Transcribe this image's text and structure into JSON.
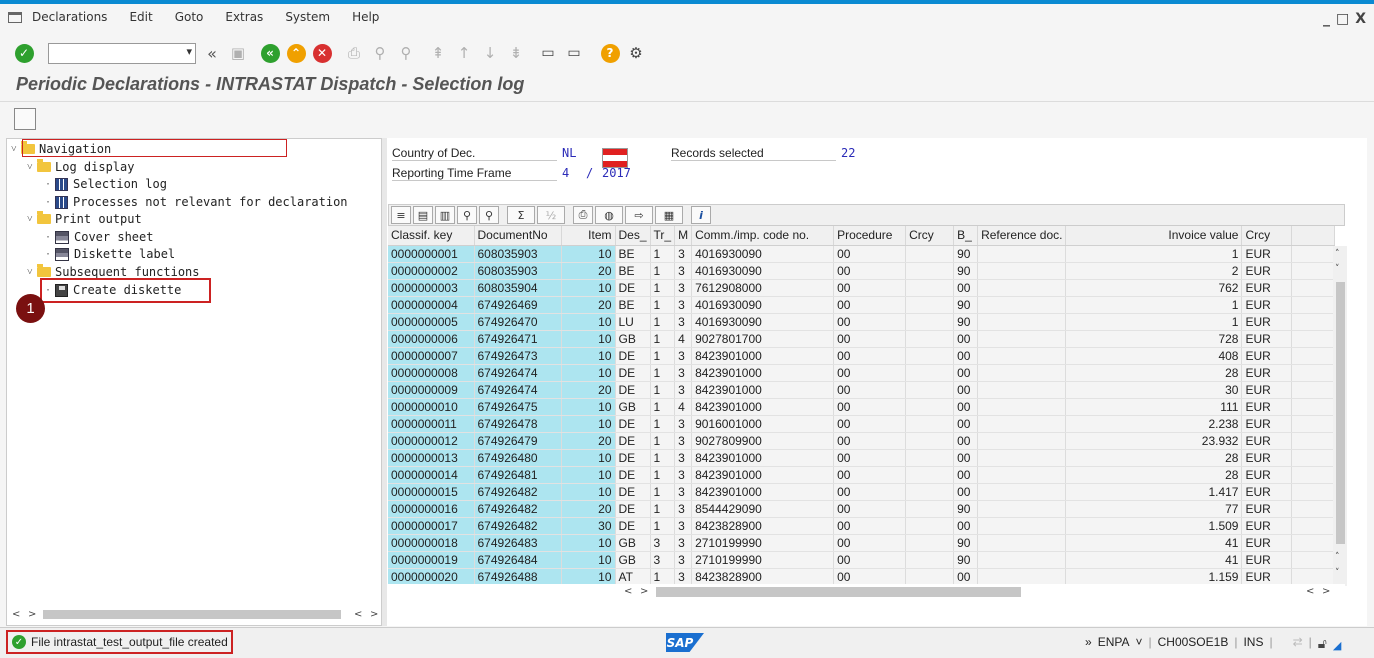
{
  "menu": {
    "items": [
      "Declarations",
      "Edit",
      "Goto",
      "Extras",
      "System",
      "Help"
    ]
  },
  "window_controls": {
    "minimize": "_",
    "maximize": "□",
    "close": "X"
  },
  "toolbar": {
    "command_field": {
      "value": "",
      "dropdown_icon": "chevron-down-icon"
    },
    "buttons": [
      "enter-icon",
      "back-double-icon",
      "save-icon",
      "back-icon",
      "exit-icon",
      "cancel-icon",
      "print-icon",
      "find-icon",
      "find-next-icon",
      "first-page-icon",
      "previous-page-icon",
      "next-page-icon",
      "last-page-icon",
      "new-session-icon",
      "shortcut-icon",
      "help-icon",
      "settings-icon"
    ],
    "colors": {
      "enter": "#2ea02e",
      "back": "#2ea02e",
      "exit": "#f0a000",
      "cancel": "#d83030",
      "help": "#f0a000"
    }
  },
  "page": {
    "title": "Periodic Declarations - INTRASTAT Dispatch - Selection log"
  },
  "tree": {
    "nodes": [
      {
        "label": "Navigation",
        "level": 0,
        "type": "folder"
      },
      {
        "label": "Log display",
        "level": 1,
        "type": "folder"
      },
      {
        "label": "Selection log",
        "level": 2,
        "type": "list"
      },
      {
        "label": "Processes not relevant for declaration",
        "level": 2,
        "type": "list"
      },
      {
        "label": "Print output",
        "level": 1,
        "type": "folder"
      },
      {
        "label": "Cover sheet",
        "level": 2,
        "type": "print"
      },
      {
        "label": "Diskette label",
        "level": 2,
        "type": "print"
      },
      {
        "label": "Subsequent functions",
        "level": 1,
        "type": "folder"
      },
      {
        "label": "Create diskette",
        "level": 2,
        "type": "disk"
      }
    ],
    "annotation_badge": "1"
  },
  "header": {
    "country_label": "Country of Dec.",
    "country_value": "NL",
    "records_label": "Records selected",
    "records_value": "22",
    "period_label": "Reporting Time Frame",
    "period_month": "4",
    "period_sep": "/",
    "period_year": "2017"
  },
  "grid": {
    "toolbar_buttons": [
      "details-icon",
      "sort-asc-icon",
      "sort-desc-icon",
      "find-icon",
      "filter-icon",
      "sum-icon",
      "subtotal-icon",
      "print-icon",
      "view-icon",
      "export-icon",
      "layout-icon",
      "info-icon"
    ],
    "columns": [
      "Classif. key",
      "DocumentNo",
      "Item",
      "Des_",
      "Tr_",
      "M",
      "Comm./imp. code no.",
      "Procedure",
      "Crcy",
      "B_",
      "Reference doc.",
      "Invoice value",
      "Crcy"
    ],
    "rows": [
      [
        "0000000001",
        "608035903",
        "10",
        "BE",
        "1",
        "3",
        "4016930090",
        "00",
        "",
        "90",
        "",
        "1",
        "EUR"
      ],
      [
        "0000000002",
        "608035903",
        "20",
        "BE",
        "1",
        "3",
        "4016930090",
        "00",
        "",
        "90",
        "",
        "2",
        "EUR"
      ],
      [
        "0000000003",
        "608035904",
        "10",
        "DE",
        "1",
        "3",
        "7612908000",
        "00",
        "",
        "00",
        "",
        "762",
        "EUR"
      ],
      [
        "0000000004",
        "674926469",
        "20",
        "BE",
        "1",
        "3",
        "4016930090",
        "00",
        "",
        "90",
        "",
        "1",
        "EUR"
      ],
      [
        "0000000005",
        "674926470",
        "10",
        "LU",
        "1",
        "3",
        "4016930090",
        "00",
        "",
        "90",
        "",
        "1",
        "EUR"
      ],
      [
        "0000000006",
        "674926471",
        "10",
        "GB",
        "1",
        "4",
        "9027801700",
        "00",
        "",
        "00",
        "",
        "728",
        "EUR"
      ],
      [
        "0000000007",
        "674926473",
        "10",
        "DE",
        "1",
        "3",
        "8423901000",
        "00",
        "",
        "00",
        "",
        "408",
        "EUR"
      ],
      [
        "0000000008",
        "674926474",
        "10",
        "DE",
        "1",
        "3",
        "8423901000",
        "00",
        "",
        "00",
        "",
        "28",
        "EUR"
      ],
      [
        "0000000009",
        "674926474",
        "20",
        "DE",
        "1",
        "3",
        "8423901000",
        "00",
        "",
        "00",
        "",
        "30",
        "EUR"
      ],
      [
        "0000000010",
        "674926475",
        "10",
        "GB",
        "1",
        "4",
        "8423901000",
        "00",
        "",
        "00",
        "",
        "111",
        "EUR"
      ],
      [
        "0000000011",
        "674926478",
        "10",
        "DE",
        "1",
        "3",
        "9016001000",
        "00",
        "",
        "00",
        "",
        "2.238",
        "EUR"
      ],
      [
        "0000000012",
        "674926479",
        "20",
        "DE",
        "1",
        "3",
        "9027809900",
        "00",
        "",
        "00",
        "",
        "23.932",
        "EUR"
      ],
      [
        "0000000013",
        "674926480",
        "10",
        "DE",
        "1",
        "3",
        "8423901000",
        "00",
        "",
        "00",
        "",
        "28",
        "EUR"
      ],
      [
        "0000000014",
        "674926481",
        "10",
        "DE",
        "1",
        "3",
        "8423901000",
        "00",
        "",
        "00",
        "",
        "28",
        "EUR"
      ],
      [
        "0000000015",
        "674926482",
        "10",
        "DE",
        "1",
        "3",
        "8423901000",
        "00",
        "",
        "00",
        "",
        "1.417",
        "EUR"
      ],
      [
        "0000000016",
        "674926482",
        "20",
        "DE",
        "1",
        "3",
        "8544429090",
        "00",
        "",
        "90",
        "",
        "77",
        "EUR"
      ],
      [
        "0000000017",
        "674926482",
        "30",
        "DE",
        "1",
        "3",
        "8423828900",
        "00",
        "",
        "00",
        "",
        "1.509",
        "EUR"
      ],
      [
        "0000000018",
        "674926483",
        "10",
        "GB",
        "3",
        "3",
        "2710199990",
        "00",
        "",
        "90",
        "",
        "41",
        "EUR"
      ],
      [
        "0000000019",
        "674926484",
        "10",
        "GB",
        "3",
        "3",
        "2710199990",
        "00",
        "",
        "90",
        "",
        "41",
        "EUR"
      ],
      [
        "0000000020",
        "674926488",
        "10",
        "AT",
        "1",
        "3",
        "8423828900",
        "00",
        "",
        "00",
        "",
        "1.159",
        "EUR"
      ]
    ]
  },
  "status": {
    "message": "File intrastat_test_output_file created",
    "logo": "SAP",
    "system_arrow": "»",
    "system": "ENPA",
    "system_dropdown": "˅",
    "server": "CH00SOE1B",
    "mode": "INS",
    "sep": "|"
  }
}
